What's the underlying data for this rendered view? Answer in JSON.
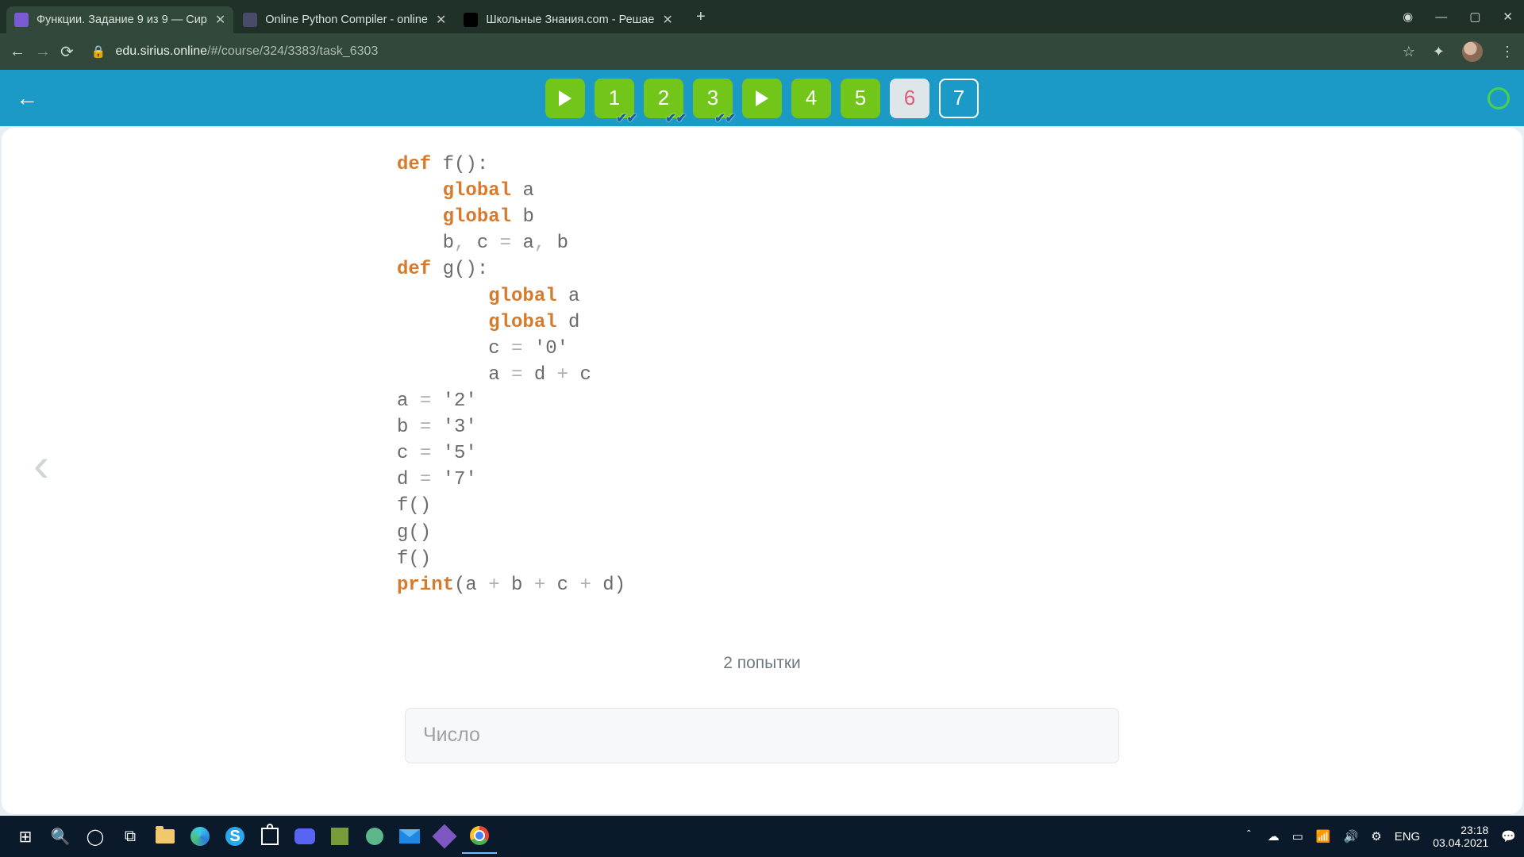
{
  "browser": {
    "tabs": [
      {
        "title": "Функции. Задание 9 из 9 — Сир",
        "active": true,
        "favicon_bg": "#7a5bd4"
      },
      {
        "title": "Online Python Compiler - online",
        "active": false,
        "favicon_bg": "#4a4a6a"
      },
      {
        "title": "Школьные Знания.com - Решае",
        "active": false,
        "favicon_bg": "#000000"
      }
    ],
    "url_host": "edu.sirius.online",
    "url_path": "/#/course/324/3383/task_6303"
  },
  "sirius": {
    "nav": [
      {
        "kind": "play"
      },
      {
        "kind": "num",
        "label": "1",
        "checked": true
      },
      {
        "kind": "num",
        "label": "2",
        "checked": true
      },
      {
        "kind": "num",
        "label": "3",
        "checked": true
      },
      {
        "kind": "play"
      },
      {
        "kind": "num",
        "label": "4",
        "checked": false
      },
      {
        "kind": "num",
        "label": "5",
        "checked": false
      },
      {
        "kind": "gray",
        "label": "6"
      },
      {
        "kind": "outline",
        "label": "7"
      }
    ]
  },
  "code": {
    "lines": [
      [
        {
          "t": "def ",
          "c": "kw"
        },
        {
          "t": "f():",
          "c": ""
        }
      ],
      [
        {
          "t": "    ",
          "c": ""
        },
        {
          "t": "global ",
          "c": "kw"
        },
        {
          "t": "a",
          "c": ""
        }
      ],
      [
        {
          "t": "    ",
          "c": ""
        },
        {
          "t": "global ",
          "c": "kw"
        },
        {
          "t": "b",
          "c": ""
        }
      ],
      [
        {
          "t": "    b",
          "c": ""
        },
        {
          "t": ", ",
          "c": "op"
        },
        {
          "t": "c ",
          "c": ""
        },
        {
          "t": "= ",
          "c": "op"
        },
        {
          "t": "a",
          "c": ""
        },
        {
          "t": ", ",
          "c": "op"
        },
        {
          "t": "b",
          "c": ""
        }
      ],
      [
        {
          "t": "def ",
          "c": "kw"
        },
        {
          "t": "g():",
          "c": ""
        }
      ],
      [
        {
          "t": "        ",
          "c": ""
        },
        {
          "t": "global ",
          "c": "kw"
        },
        {
          "t": "a",
          "c": ""
        }
      ],
      [
        {
          "t": "        ",
          "c": ""
        },
        {
          "t": "global ",
          "c": "kw"
        },
        {
          "t": "d",
          "c": ""
        }
      ],
      [
        {
          "t": "        c ",
          "c": ""
        },
        {
          "t": "= ",
          "c": "op"
        },
        {
          "t": "'0'",
          "c": "str"
        }
      ],
      [
        {
          "t": "        a ",
          "c": ""
        },
        {
          "t": "= ",
          "c": "op"
        },
        {
          "t": "d ",
          "c": ""
        },
        {
          "t": "+ ",
          "c": "op"
        },
        {
          "t": "c",
          "c": ""
        }
      ],
      [
        {
          "t": "a ",
          "c": ""
        },
        {
          "t": "= ",
          "c": "op"
        },
        {
          "t": "'2'",
          "c": "str"
        }
      ],
      [
        {
          "t": "b ",
          "c": ""
        },
        {
          "t": "= ",
          "c": "op"
        },
        {
          "t": "'3'",
          "c": "str"
        }
      ],
      [
        {
          "t": "c ",
          "c": ""
        },
        {
          "t": "= ",
          "c": "op"
        },
        {
          "t": "'5'",
          "c": "str"
        }
      ],
      [
        {
          "t": "d ",
          "c": ""
        },
        {
          "t": "= ",
          "c": "op"
        },
        {
          "t": "'7'",
          "c": "str"
        }
      ],
      [
        {
          "t": "f()",
          "c": ""
        }
      ],
      [
        {
          "t": "g()",
          "c": ""
        }
      ],
      [
        {
          "t": "f()",
          "c": ""
        }
      ],
      [
        {
          "t": "print",
          "c": "pr"
        },
        {
          "t": "(a ",
          "c": ""
        },
        {
          "t": "+ ",
          "c": "op"
        },
        {
          "t": "b ",
          "c": ""
        },
        {
          "t": "+ ",
          "c": "op"
        },
        {
          "t": "c ",
          "c": ""
        },
        {
          "t": "+ ",
          "c": "op"
        },
        {
          "t": "d)",
          "c": ""
        }
      ]
    ]
  },
  "attempts_label": "2 попытки",
  "answer_placeholder": "Число",
  "system": {
    "lang": "ENG",
    "time": "23:18",
    "date": "03.04.2021"
  }
}
